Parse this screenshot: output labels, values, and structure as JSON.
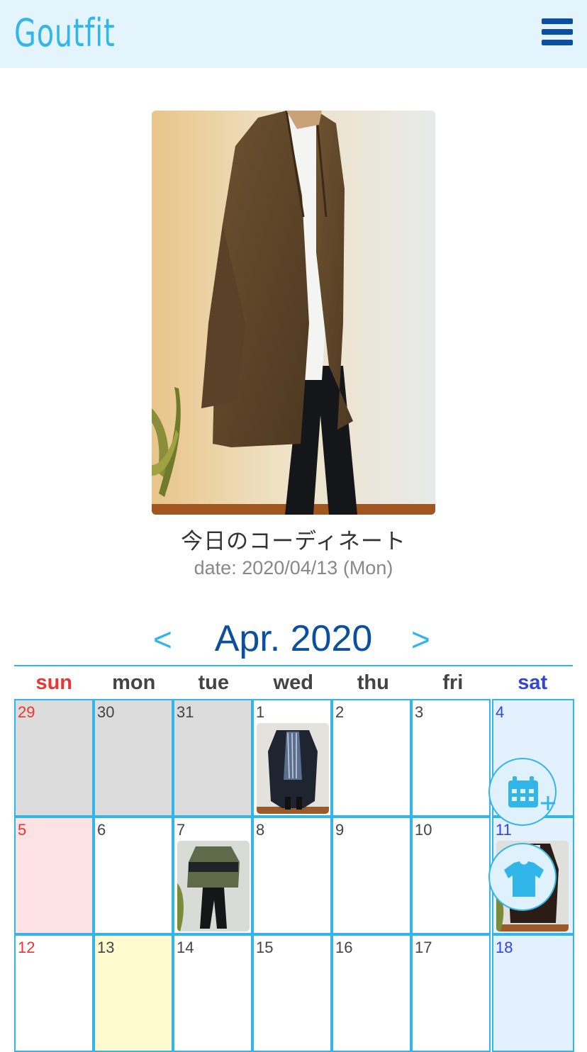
{
  "app": {
    "title": "Goutfit"
  },
  "hero": {
    "caption": "今日のコーディネート",
    "date": "date: 2020/04/13 (Mon)"
  },
  "calendar": {
    "month_label": "Apr. 2020",
    "prev": "<",
    "next": ">",
    "weekdays": [
      "sun",
      "mon",
      "tue",
      "wed",
      "thu",
      "fri",
      "sat"
    ],
    "days": [
      "29",
      "30",
      "31",
      "1",
      "2",
      "3",
      "4",
      "5",
      "6",
      "7",
      "8",
      "9",
      "10",
      "11",
      "12",
      "13",
      "14",
      "15",
      "16",
      "17",
      "18"
    ]
  },
  "icons": {
    "menu": "hamburger-menu-icon",
    "add_calendar": "calendar-plus-icon",
    "clothes": "tshirt-icon"
  },
  "colors": {
    "header_bg": "#e3f4fd",
    "brand": "#31b6ea",
    "navy": "#0b4fa0",
    "sunday": "#ee3333",
    "saturday": "#3344dd"
  }
}
